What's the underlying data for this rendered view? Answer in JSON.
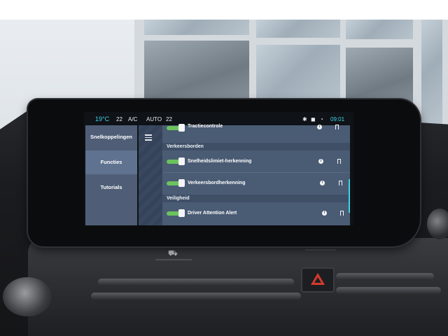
{
  "status_bar": {
    "temperature": "19°C",
    "fan_level": "22",
    "ac_label": "A/C",
    "auto_label": "AUTO",
    "fan_level_2": "22",
    "time": "09:01",
    "icons": [
      "bluetooth-icon",
      "car-icon",
      "signal-icon"
    ]
  },
  "side_menu": {
    "items": [
      {
        "label": "Snelkoppelingen",
        "active": false
      },
      {
        "label": "Functies",
        "active": true
      },
      {
        "label": "Tutorials",
        "active": false
      }
    ]
  },
  "content": {
    "menu_icon": "hamburger-icon",
    "rows": [
      {
        "type": "item",
        "label": "Tractiecontrole",
        "enabled": true
      },
      {
        "type": "header",
        "label": "Verkeersborden"
      },
      {
        "type": "item",
        "label": "Snelheidslimiet-herkenning",
        "enabled": true
      },
      {
        "type": "item",
        "label": "Verkeersbordherkenning",
        "enabled": true
      },
      {
        "type": "header",
        "label": "Veiligheid"
      },
      {
        "type": "item",
        "label": "Driver Attention Alert",
        "enabled": true
      }
    ],
    "row_icons": [
      "info-icon",
      "bookmark-icon"
    ]
  },
  "colors": {
    "accent": "#3fd3e6",
    "toggle_on": "#6bc35d",
    "panel": "#4a5b74",
    "hazard": "#d63a2e"
  }
}
